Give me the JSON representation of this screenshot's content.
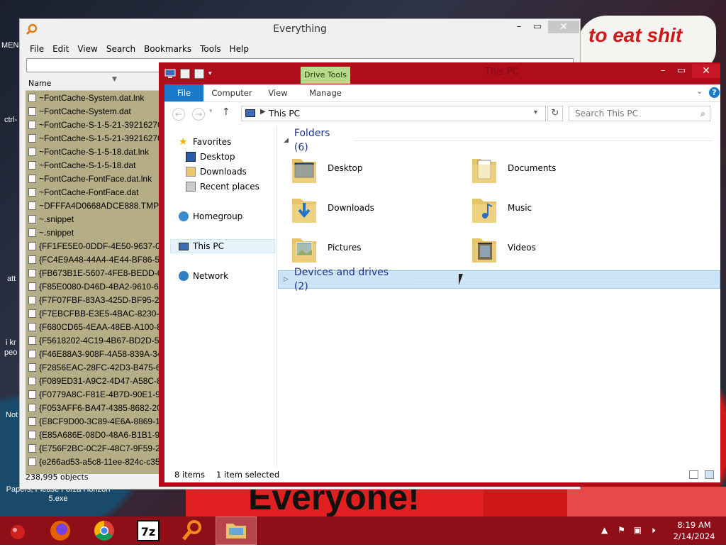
{
  "background": {
    "sign_text": "to eat shit",
    "banner_text": "Everyone!",
    "caption_text": "Papers, Please Forza Horizon 5.exe",
    "left_labels": [
      "MEN",
      "ctrl-",
      "i kr",
      "peo",
      "Not",
      "att"
    ]
  },
  "everything": {
    "title": "Everything",
    "menu": [
      "File",
      "Edit",
      "View",
      "Search",
      "Bookmarks",
      "Tools",
      "Help"
    ],
    "column_name": "Name",
    "status": "238,995 objects",
    "rows": [
      "~FontCache-System.dat.lnk",
      "~FontCache-System.dat",
      "~FontCache-S-1-5-21-39216270",
      "~FontCache-S-1-5-21-39216270",
      "~FontCache-S-1-5-18.dat.lnk",
      "~FontCache-S-1-5-18.dat",
      "~FontCache-FontFace.dat.lnk",
      "~FontCache-FontFace.dat",
      "~DFFFA4D0668ADCE888.TMP",
      "~.snippet",
      "~.snippet",
      "{FF1FE5E0-0DDF-4E50-9637-0C0",
      "{FC4E9A48-44A4-4E44-BF86-5BE",
      "{FB673B1E-5607-4FE8-BEDD-634",
      "{F85E0080-D46D-4BA2-9610-66D",
      "{F7F07FBF-83A3-425D-BF95-2A5",
      "{F7EBCFBB-E3E5-4BAC-8230-34",
      "{F680CD65-4EAA-48EB-A100-8E",
      "{F5618202-4C19-4B67-BD2D-55E",
      "{F46E88A3-908F-4A58-839A-345",
      "{F2856EAC-28FC-42D3-B475-6D",
      "{F089ED31-A9C2-4D47-A58C-88",
      "{F0779A8C-F81E-4B7D-90E1-994",
      "{F053AFF6-BA47-4385-8682-20D",
      "{E8CF9D00-3C89-4E6A-8869-128",
      "{E85A686E-08D0-48A6-B1B1-975",
      "{E756F2BC-0C2F-48C7-9F59-20F",
      "{e266ad53-a5c8-11ee-824c-c351"
    ]
  },
  "explorer": {
    "title": "This PC",
    "context_tab": "Drive Tools",
    "ribbon_tabs": [
      "File",
      "Computer",
      "View",
      "Manage"
    ],
    "address": "This PC",
    "search_placeholder": "Search This PC",
    "nav": {
      "favorites": "Favorites",
      "desktop": "Desktop",
      "downloads": "Downloads",
      "recent": "Recent places",
      "homegroup": "Homegroup",
      "this_pc": "This PC",
      "network": "Network"
    },
    "folders_header": "Folders (6)",
    "folders": [
      "Desktop",
      "Documents",
      "Downloads",
      "Music",
      "Pictures",
      "Videos"
    ],
    "devices_header": "Devices and drives (2)",
    "status_items": "8 items",
    "status_selected": "1 item selected"
  },
  "taskbar": {
    "time": "8:19 AM",
    "date": "2/14/2024",
    "apps": [
      "firefox",
      "chrome",
      "7-zip",
      "everything",
      "file-explorer"
    ]
  },
  "colors": {
    "accent": "#b00d1a",
    "ribbon_file": "#1979ca",
    "taskbar": "#8f0f18",
    "everything_list": "#b4ad86"
  }
}
